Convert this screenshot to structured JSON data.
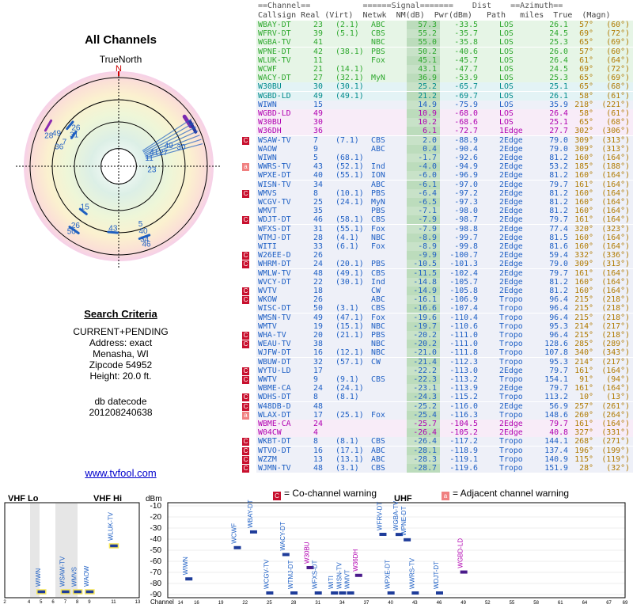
{
  "page": {
    "title": "All Channels",
    "true_north": "TrueNorth",
    "north": "N",
    "website": "www.tvfool.com"
  },
  "criteria": {
    "heading": "Search Criteria",
    "lines": [
      "CURRENT+PENDING",
      "Address: exact",
      "Menasha, WI",
      "Zipcode 54952",
      "Height: 20.0 ft."
    ],
    "datecode_label": "db datecode",
    "datecode": "201208240638"
  },
  "headers": {
    "top": "==Channel==           ======Signal=======    Dist    ==Azimuth==",
    "cols": "Callsign Real (Virt)  Netwk  NM(dB)  Pwr(dBm)   Path   miles  True  (Magn)"
  },
  "colors": {
    "green": "#2ea82e",
    "cyan": "#008b8b",
    "blue": "#1e5fc4",
    "magenta": "#b000b0",
    "red": "#d00000",
    "warn": "#c8102e",
    "warn_adj": "#f08080"
  },
  "rows": [
    [
      "WBAY-DT",
      "23",
      "(2.1)",
      "ABC",
      "57.3",
      "-33.5",
      "LOS",
      "26.1",
      "57°",
      "(60°)",
      "green",
      ""
    ],
    [
      "WFRV-DT",
      "39",
      "(5.1)",
      "CBS",
      "55.2",
      "-35.7",
      "LOS",
      "24.5",
      "69°",
      "(72°)",
      "green",
      ""
    ],
    [
      "WGBA-TV",
      "41",
      "",
      "NBC",
      "55.0",
      "-35.8",
      "LOS",
      "25.3",
      "65°",
      "(69°)",
      "green",
      ""
    ],
    [
      "WPNE-DT",
      "42",
      "(38.1)",
      "PBS",
      "50.2",
      "-40.6",
      "LOS",
      "26.0",
      "57°",
      "(60°)",
      "green",
      ""
    ],
    [
      "WLUK-TV",
      "11",
      "",
      "Fox",
      "45.1",
      "-45.7",
      "LOS",
      "26.4",
      "61°",
      "(64°)",
      "green",
      ""
    ],
    [
      "WCWF",
      "21",
      "(14.1)",
      "",
      "43.1",
      "-47.7",
      "LOS",
      "24.5",
      "69°",
      "(72°)",
      "green",
      ""
    ],
    [
      "WACY-DT",
      "27",
      "(32.1)",
      "MyN",
      "36.9",
      "-53.9",
      "LOS",
      "25.3",
      "65°",
      "(69°)",
      "green",
      ""
    ],
    [
      "W30BU",
      "30",
      "(30.1)",
      "",
      "25.2",
      "-65.7",
      "LOS",
      "25.1",
      "65°",
      "(68°)",
      "cyan",
      ""
    ],
    [
      "WGBD-LD",
      "49",
      "(49.1)",
      "",
      "21.2",
      "-69.7",
      "LOS",
      "26.1",
      "58°",
      "(61°)",
      "cyan",
      ""
    ],
    [
      "WIWN",
      "15",
      "",
      "",
      "14.9",
      "-75.9",
      "LOS",
      "35.9",
      "218°",
      "(221°)",
      "blue",
      ""
    ],
    [
      "WGBD-LD",
      "49",
      "",
      "",
      "10.9",
      "-68.0",
      "LOS",
      "26.4",
      "58°",
      "(61°)",
      "magenta",
      ""
    ],
    [
      "W30BU",
      "30",
      "",
      "",
      "10.2",
      "-68.6",
      "LOS",
      "25.1",
      "65°",
      "(68°)",
      "magenta",
      ""
    ],
    [
      "W36DH",
      "36",
      "",
      "",
      "6.1",
      "-72.7",
      "1Edge",
      "27.7",
      "302°",
      "(306°)",
      "magenta",
      ""
    ],
    [
      "WSAW-TV",
      "7",
      "(7.1)",
      "CBS",
      "2.0",
      "-88.9",
      "2Edge",
      "79.0",
      "309°",
      "(313°)",
      "blue",
      "C"
    ],
    [
      "WAOW",
      "9",
      "",
      "ABC",
      "0.4",
      "-90.4",
      "2Edge",
      "79.0",
      "309°",
      "(313°)",
      "blue",
      ""
    ],
    [
      "WIWN",
      "5",
      "(68.1)",
      "",
      "-1.7",
      "-92.6",
      "2Edge",
      "81.2",
      "160°",
      "(164°)",
      "blue",
      ""
    ],
    [
      "WWRS-TV",
      "43",
      "(52.1)",
      "Ind",
      "-4.0",
      "-94.9",
      "2Edge",
      "53.2",
      "185°",
      "(188°)",
      "blue",
      "A"
    ],
    [
      "WPXE-DT",
      "40",
      "(55.1)",
      "ION",
      "-6.0",
      "-96.9",
      "2Edge",
      "81.2",
      "160°",
      "(164°)",
      "blue",
      ""
    ],
    [
      "WISN-TV",
      "34",
      "",
      "ABC",
      "-6.1",
      "-97.0",
      "2Edge",
      "79.7",
      "161°",
      "(164°)",
      "blue",
      ""
    ],
    [
      "WMVS",
      "8",
      "(10.1)",
      "PBS",
      "-6.4",
      "-97.2",
      "2Edge",
      "81.2",
      "160°",
      "(164°)",
      "blue",
      "C"
    ],
    [
      "WCGV-TV",
      "25",
      "(24.1)",
      "MyN",
      "-6.5",
      "-97.3",
      "2Edge",
      "81.2",
      "160°",
      "(164°)",
      "blue",
      ""
    ],
    [
      "WMVT",
      "35",
      "",
      "PBS",
      "-7.1",
      "-98.0",
      "2Edge",
      "81.2",
      "160°",
      "(164°)",
      "blue",
      ""
    ],
    [
      "WDJT-DT",
      "46",
      "(58.1)",
      "CBS",
      "-7.9",
      "-98.7",
      "2Edge",
      "79.7",
      "161°",
      "(164°)",
      "blue",
      "C"
    ],
    [
      "WFXS-DT",
      "31",
      "(55.1)",
      "Fox",
      "-7.9",
      "-98.8",
      "2Edge",
      "77.4",
      "320°",
      "(323°)",
      "blue",
      ""
    ],
    [
      "WTMJ-DT",
      "28",
      "(4.1)",
      "NBC",
      "-8.9",
      "-99.7",
      "2Edge",
      "81.5",
      "160°",
      "(164°)",
      "blue",
      ""
    ],
    [
      "WITI",
      "33",
      "(6.1)",
      "Fox",
      "-8.9",
      "-99.8",
      "2Edge",
      "81.6",
      "160°",
      "(164°)",
      "blue",
      ""
    ],
    [
      "W26EE-D",
      "26",
      "",
      "",
      "-9.9",
      "-100.7",
      "2Edge",
      "59.4",
      "332°",
      "(336°)",
      "blue",
      "C"
    ],
    [
      "WHRM-DT",
      "24",
      "(20.1)",
      "PBS",
      "-10.5",
      "-101.3",
      "2Edge",
      "79.0",
      "309°",
      "(313°)",
      "blue",
      "C"
    ],
    [
      "WMLW-TV",
      "48",
      "(49.1)",
      "CBS",
      "-11.5",
      "-102.4",
      "2Edge",
      "79.7",
      "161°",
      "(164°)",
      "blue",
      ""
    ],
    [
      "WVCY-DT",
      "22",
      "(30.1)",
      "Ind",
      "-14.8",
      "-105.7",
      "2Edge",
      "81.2",
      "160°",
      "(164°)",
      "blue",
      ""
    ],
    [
      "WVTV",
      "18",
      "",
      "CW",
      "-14.9",
      "-105.8",
      "2Edge",
      "81.2",
      "160°",
      "(164°)",
      "blue",
      "C"
    ],
    [
      "WKOW",
      "26",
      "",
      "ABC",
      "-16.1",
      "-106.9",
      "Tropo",
      "96.4",
      "215°",
      "(218°)",
      "blue",
      "C"
    ],
    [
      "WISC-DT",
      "50",
      "(3.1)",
      "CBS",
      "-16.6",
      "-107.4",
      "Tropo",
      "96.4",
      "215°",
      "(218°)",
      "blue",
      ""
    ],
    [
      "WMSN-TV",
      "49",
      "(47.1)",
      "Fox",
      "-19.6",
      "-110.4",
      "Tropo",
      "96.4",
      "215°",
      "(218°)",
      "blue",
      ""
    ],
    [
      "WMTV",
      "19",
      "(15.1)",
      "NBC",
      "-19.7",
      "-110.6",
      "Tropo",
      "95.3",
      "214°",
      "(217°)",
      "blue",
      ""
    ],
    [
      "WHA-TV",
      "20",
      "(21.1)",
      "PBS",
      "-20.2",
      "-111.0",
      "Tropo",
      "96.4",
      "215°",
      "(218°)",
      "blue",
      "C"
    ],
    [
      "WEAU-TV",
      "38",
      "",
      "NBC",
      "-20.2",
      "-111.0",
      "Tropo",
      "128.6",
      "285°",
      "(289°)",
      "blue",
      "C"
    ],
    [
      "WJFW-DT",
      "16",
      "(12.1)",
      "NBC",
      "-21.0",
      "-111.8",
      "Tropo",
      "107.8",
      "340°",
      "(343°)",
      "blue",
      ""
    ],
    [
      "WBUW-DT",
      "32",
      "(57.1)",
      "CW",
      "-21.4",
      "-112.3",
      "Tropo",
      "95.3",
      "214°",
      "(217°)",
      "blue",
      ""
    ],
    [
      "WYTU-LD",
      "17",
      "",
      "",
      "-22.2",
      "-113.0",
      "2Edge",
      "79.7",
      "161°",
      "(164°)",
      "blue",
      "C"
    ],
    [
      "WWTV",
      "9",
      "(9.1)",
      "CBS",
      "-22.3",
      "-113.2",
      "Tropo",
      "154.1",
      "91°",
      "(94°)",
      "blue",
      "C"
    ],
    [
      "WBME-CA",
      "24",
      "(24.1)",
      "",
      "-23.1",
      "-113.9",
      "2Edge",
      "79.7",
      "161°",
      "(164°)",
      "blue",
      ""
    ],
    [
      "WDHS-DT",
      "8",
      "(8.1)",
      "",
      "-24.3",
      "-115.2",
      "Tropo",
      "113.2",
      "10°",
      "(13°)",
      "blue",
      "C"
    ],
    [
      "W48DB-D",
      "48",
      "",
      "",
      "-25.2",
      "-116.0",
      "2Edge",
      "56.9",
      "257°",
      "(261°)",
      "blue",
      "C"
    ],
    [
      "WLAX-DT",
      "17",
      "(25.1)",
      "Fox",
      "-25.4",
      "-116.3",
      "Tropo",
      "148.6",
      "260°",
      "(264°)",
      "blue",
      "A"
    ],
    [
      "WBME-CA",
      "24",
      "",
      "",
      "-25.7",
      "-104.5",
      "2Edge",
      "79.7",
      "161°",
      "(164°)",
      "magenta",
      ""
    ],
    [
      "W04CW",
      "4",
      "",
      "",
      "-26.4",
      "-105.2",
      "2Edge",
      "40.8",
      "327°",
      "(331°)",
      "magenta",
      ""
    ],
    [
      "WKBT-DT",
      "8",
      "(8.1)",
      "CBS",
      "-26.4",
      "-117.2",
      "Tropo",
      "144.1",
      "268°",
      "(271°)",
      "blue",
      "C"
    ],
    [
      "WTVO-DT",
      "16",
      "(17.1)",
      "ABC",
      "-28.1",
      "-118.9",
      "Tropo",
      "137.4",
      "196°",
      "(199°)",
      "blue",
      "C"
    ],
    [
      "WZZM",
      "13",
      "(13.1)",
      "ABC",
      "-28.3",
      "-119.1",
      "Tropo",
      "140.9",
      "115°",
      "(119°)",
      "blue",
      "C"
    ],
    [
      "WJMN-TV",
      "48",
      "(3.1)",
      "CBS",
      "-28.7",
      "-119.6",
      "Tropo",
      "151.9",
      "28°",
      "(32°)",
      "blue",
      "C"
    ]
  ],
  "legend": {
    "co": "= Co-channel warning",
    "adj": "= Adjacent channel warning",
    "co_mark": "C",
    "adj_mark": "a"
  },
  "chart_data": [
    {
      "type": "scatter",
      "title": "All Channels",
      "projection": "polar",
      "north_label": "TrueNorth",
      "points": [
        {
          "label": "WBAY-DT",
          "azimuth": 57,
          "signal": 57.3
        },
        {
          "label": "WFRV-DT",
          "azimuth": 69,
          "signal": 55.2
        },
        {
          "label": "WGBA-TV",
          "azimuth": 65,
          "signal": 55.0
        },
        {
          "label": "WPNE-DT",
          "azimuth": 57,
          "signal": 50.2
        },
        {
          "label": "WLUK-TV",
          "azimuth": 61,
          "signal": 45.1
        },
        {
          "label": "WIWN",
          "azimuth": 218,
          "signal": 14.9
        },
        {
          "label": "WSAW-TV",
          "azimuth": 309,
          "signal": 2.0
        },
        {
          "label": "WWRS-TV",
          "azimuth": 185,
          "signal": -4.0
        }
      ],
      "labels": [
        {
          "t": "26",
          "a": 310,
          "r": 0.63
        },
        {
          "t": "31",
          "a": 303,
          "r": 0.6
        },
        {
          "t": "28",
          "a": 292,
          "r": 0.85
        },
        {
          "t": "49",
          "a": 296,
          "r": 0.78
        },
        {
          "t": "7",
          "a": 292,
          "r": 0.66
        },
        {
          "t": "36",
          "a": 286,
          "r": 0.7
        },
        {
          "t": "49",
          "a": 70,
          "r": 0.6
        },
        {
          "t": "30",
          "a": 75,
          "r": 0.73
        },
        {
          "t": "27",
          "a": 76,
          "r": 0.52
        },
        {
          "t": "23",
          "a": 100,
          "r": 0.38
        },
        {
          "t": "41",
          "a": 72,
          "r": 0.42
        },
        {
          "t": "11",
          "a": 80,
          "r": 0.35
        },
        {
          "t": "15",
          "a": 218,
          "r": 0.62
        },
        {
          "t": "26",
          "a": 215,
          "r": 0.85
        },
        {
          "t": "50",
          "a": 215,
          "r": 0.93
        },
        {
          "t": "43",
          "a": 185,
          "r": 0.73
        },
        {
          "t": "5",
          "a": 160,
          "r": 0.72
        },
        {
          "t": "40",
          "a": 160,
          "r": 0.81
        },
        {
          "t": "34",
          "a": 161,
          "r": 0.9
        },
        {
          "t": "46",
          "a": 161,
          "r": 0.96
        }
      ]
    },
    {
      "type": "bar",
      "title": "VHF Lo",
      "ylabel": "dBm",
      "ylim": [
        -90,
        -10
      ],
      "yticks": [
        -10,
        -20,
        -30,
        -40,
        -50,
        -60,
        -70,
        -80,
        -90
      ],
      "x": [
        2,
        4,
        5,
        6,
        7,
        8,
        9,
        11,
        13
      ],
      "bars": [
        {
          "label": "WIWN",
          "channel": 5,
          "dbm": -92.6
        },
        {
          "label": "WSAW-TV",
          "channel": 7,
          "dbm": -88.9
        },
        {
          "label": "WMVS",
          "channel": 8,
          "dbm": -97.2
        },
        {
          "label": "WAOW",
          "channel": 9,
          "dbm": -90.4
        },
        {
          "label": "WLUK-TV",
          "channel": 11,
          "dbm": -45.7
        }
      ]
    },
    {
      "type": "bar",
      "title": "UHF",
      "xlabel": "Channel",
      "x": [
        14,
        16,
        19,
        22,
        25,
        28,
        31,
        34,
        37,
        40,
        43,
        46,
        49,
        52,
        55,
        58,
        61,
        64,
        67,
        69
      ],
      "bars": [
        {
          "label": "WIWN",
          "channel": 15,
          "dbm": -75.9
        },
        {
          "label": "WCWF",
          "channel": 21,
          "dbm": -47.7
        },
        {
          "label": "WBAY-DT",
          "channel": 23,
          "dbm": -33.5
        },
        {
          "label": "WCGV-TV",
          "channel": 25,
          "dbm": -97.3
        },
        {
          "label": "WACY-DT",
          "channel": 27,
          "dbm": -53.9
        },
        {
          "label": "WTMJ-DT",
          "channel": 28,
          "dbm": -99.7
        },
        {
          "label": "W30BU",
          "channel": 30,
          "dbm": -65.7
        },
        {
          "label": "WFXS-DT",
          "channel": 31,
          "dbm": -98.8
        },
        {
          "label": "WITI",
          "channel": 33,
          "dbm": -99.8
        },
        {
          "label": "WISN-TV",
          "channel": 34,
          "dbm": -97.0
        },
        {
          "label": "WMVT",
          "channel": 35,
          "dbm": -98.0
        },
        {
          "label": "W36DH",
          "channel": 36,
          "dbm": -72.7
        },
        {
          "label": "WFRV-DT",
          "channel": 39,
          "dbm": -35.7
        },
        {
          "label": "WPXE-DT",
          "channel": 40,
          "dbm": -96.9
        },
        {
          "label": "WGBA-TV",
          "channel": 41,
          "dbm": -35.8
        },
        {
          "label": "WPNE-DT",
          "channel": 42,
          "dbm": -40.6
        },
        {
          "label": "WWRS-TV",
          "channel": 43,
          "dbm": -94.9
        },
        {
          "label": "WDJT-DT",
          "channel": 46,
          "dbm": -98.7
        },
        {
          "label": "WGBD-LD",
          "channel": 49,
          "dbm": -69.7
        }
      ]
    }
  ]
}
